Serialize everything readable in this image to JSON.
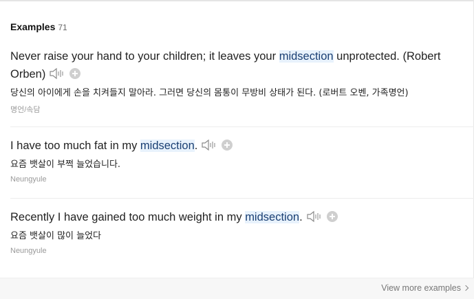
{
  "header": {
    "title": "Examples",
    "count": "71"
  },
  "examples": [
    {
      "before": "Never raise your hand to your children; it leaves your ",
      "highlight": "midsection",
      "after_main": " unprotected. (Robert",
      "after_tail": "Orben)",
      "korean": "당신의 아이에게 손을 치켜들지 말아라. 그러면 당신의 몸통이 무방비 상태가 된다. (로버트 오벤, 가족명언)",
      "source": "명언/속담"
    },
    {
      "before": "I have too much fat in my ",
      "highlight": "midsection",
      "after_main": "",
      "after_tail": ".",
      "korean": "요즘 뱃살이 부쩍 늘었습니다.",
      "source": "Neungyule"
    },
    {
      "before": "Recently I have gained too much weight in my ",
      "highlight": "midsection",
      "after_main": "",
      "after_tail": ".",
      "korean": "요즘 뱃살이 많이 늘었다",
      "source": "Neungyule"
    }
  ],
  "footer": {
    "more_label": "View more examples"
  },
  "icons": {
    "speaker": "speaker-icon",
    "add": "plus-circle-icon",
    "chevron": "chevron-right-icon"
  },
  "colors": {
    "highlight_bg": "#e8f2fc",
    "source_text": "#999999",
    "plus_bg": "#cfcfcf"
  }
}
